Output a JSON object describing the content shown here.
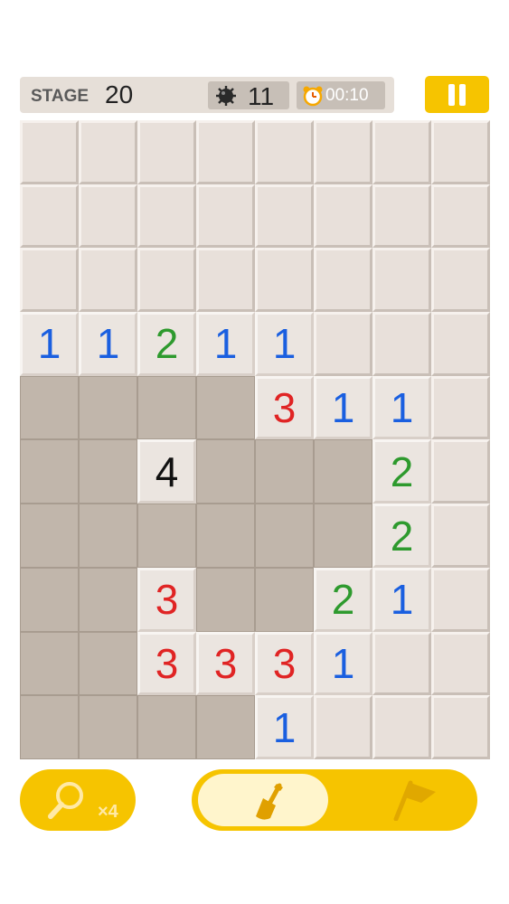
{
  "header": {
    "stage_label": "STAGE",
    "stage_number": "20",
    "mines_remaining": "11",
    "timer": "00:10",
    "pause_icon": "pause-icon",
    "mine_icon": "mine-icon",
    "clock_icon": "alarm-clock-icon"
  },
  "colors": {
    "accent": "#f6c400",
    "one": "#1a5fe0",
    "two": "#2e9a2e",
    "three": "#e02424",
    "four": "#111111"
  },
  "board": {
    "columns": 8,
    "rows": [
      [
        "",
        "",
        "",
        "",
        "",
        "",
        "",
        ""
      ],
      [
        "",
        "",
        "",
        "",
        "",
        "",
        "",
        ""
      ],
      [
        "",
        "",
        "",
        "",
        "",
        "",
        "",
        ""
      ],
      [
        "1",
        "1",
        "2",
        "1",
        "1",
        "",
        "",
        ""
      ],
      [
        "_",
        "_",
        "_",
        "_",
        "3",
        "1",
        "1",
        ""
      ],
      [
        "_",
        "_",
        "4",
        "_",
        "_",
        "_",
        "2",
        ""
      ],
      [
        "_",
        "_",
        "_",
        "_",
        "_",
        "_",
        "2",
        ""
      ],
      [
        "_",
        "_",
        "3",
        "_",
        "_",
        "2",
        "1",
        ""
      ],
      [
        "_",
        "_",
        "3",
        "3",
        "3",
        "1",
        "",
        ""
      ],
      [
        "_",
        "_",
        "_",
        "_",
        "1",
        "",
        "",
        ""
      ]
    ],
    "legend": {
      "": "hidden",
      "_": "revealed-empty"
    }
  },
  "tools": {
    "magnifier_icon": "magnifier-icon",
    "magnifier_count": "×4",
    "dig_icon": "shovel-icon",
    "flag_icon": "flag-icon",
    "active_mode": "dig"
  }
}
